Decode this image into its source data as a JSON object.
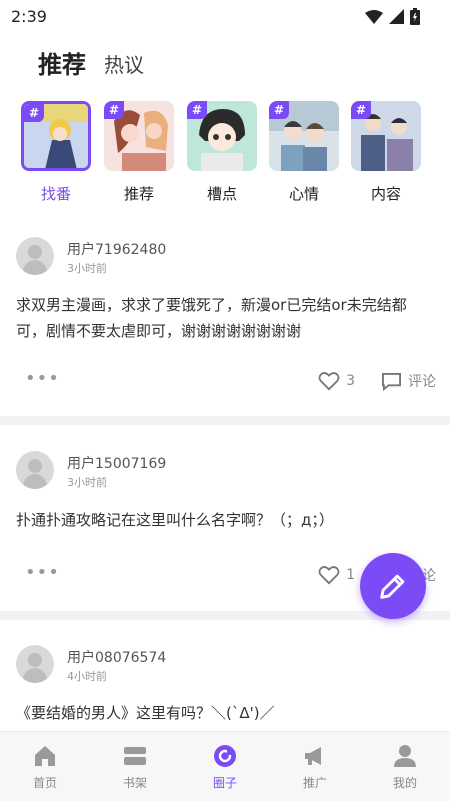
{
  "status": {
    "time": "2:39"
  },
  "tabs": [
    {
      "label": "推荐",
      "active": true
    },
    {
      "label": "热议",
      "active": false
    }
  ],
  "categories": [
    {
      "label": "找番",
      "active": true
    },
    {
      "label": "推荐",
      "active": false
    },
    {
      "label": "槽点",
      "active": false
    },
    {
      "label": "心情",
      "active": false
    },
    {
      "label": "内容",
      "active": false
    }
  ],
  "hash_symbol": "#",
  "posts": [
    {
      "username": "用户71962480",
      "time": "3小时前",
      "content": "求双男主漫画，求求了要饿死了，新漫or已完结or未完结都可，剧情不要太虐即可，谢谢谢谢谢谢谢谢",
      "likes": "3",
      "comment_label": "评论"
    },
    {
      "username": "用户15007169",
      "time": "3小时前",
      "content": "扑通扑通攻略记在这里叫什么名字啊？（；д；）",
      "likes": "1",
      "comment_label": "评论"
    },
    {
      "username": "用户08076574",
      "time": "4小时前",
      "content": "《要结婚的男人》这里有吗？＼(`Δ')／"
    }
  ],
  "more_dots": "•••",
  "nav": [
    {
      "label": "首页",
      "icon": "home-icon",
      "active": false
    },
    {
      "label": "书架",
      "icon": "bookshelf-icon",
      "active": false
    },
    {
      "label": "圈子",
      "icon": "circle-icon",
      "active": true
    },
    {
      "label": "推广",
      "icon": "megaphone-icon",
      "active": false
    },
    {
      "label": "我的",
      "icon": "profile-icon",
      "active": false
    }
  ],
  "colors": {
    "accent": "#7b4cf5",
    "underline": "#2ec1b2"
  }
}
